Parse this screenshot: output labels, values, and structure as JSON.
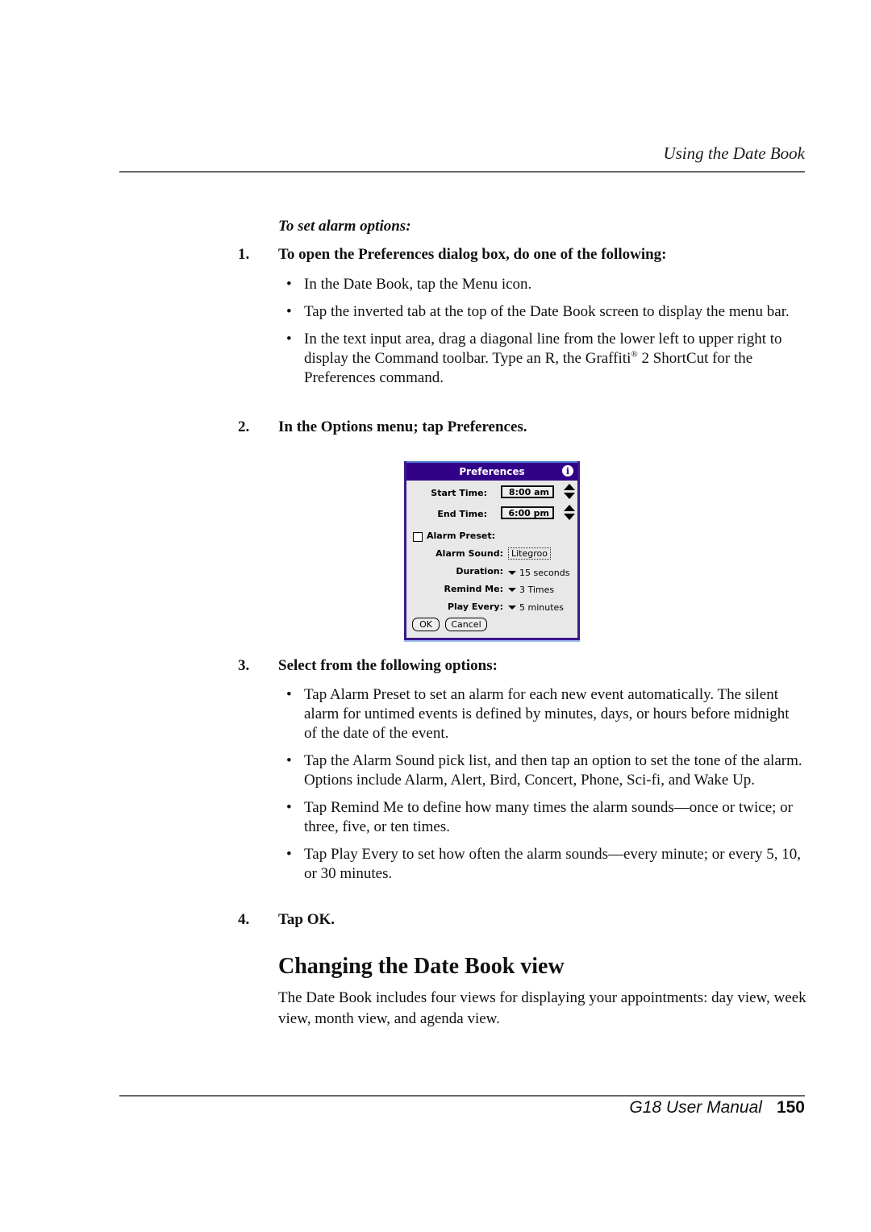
{
  "header": {
    "running_title": "Using the Date Book"
  },
  "procedure": {
    "title": "To set alarm options:",
    "steps": [
      {
        "number": "1.",
        "text": "To open the Preferences dialog box, do one of the following:",
        "bullets": [
          "In the Date Book, tap the Menu icon.",
          "Tap the inverted tab at the top of the Date Book screen to display the menu bar.",
          "In the text input area, drag a diagonal line from the lower left to upper right to display the Command toolbar. Type an R, the Graffiti",
          "®",
          " 2 ShortCut for the Preferences command."
        ]
      },
      {
        "number": "2.",
        "text": "In the Options menu; tap Preferences."
      },
      {
        "number": "3.",
        "text": "Select from the following options:",
        "bullets": [
          "Tap Alarm Preset to set an alarm for each new event automatically. The silent alarm for untimed events is defined by minutes, days, or hours before midnight of the date of the event.",
          "Tap the Alarm Sound pick list, and then tap an option to set the tone of the alarm. Options include Alarm, Alert, Bird, Concert, Phone, Sci-fi, and Wake Up.",
          "Tap Remind Me to define how many times the alarm sounds—once or twice; or three, five, or ten times.",
          "Tap Play Every to set how often the alarm sounds—every minute; or every 5, 10, or 30 minutes."
        ]
      },
      {
        "number": "4.",
        "text": "Tap OK."
      }
    ]
  },
  "dialog": {
    "title": "Preferences",
    "info_icon": "i",
    "start_time_label": "Start Time:",
    "start_time_value": "8:00 am",
    "end_time_label": "End Time:",
    "end_time_value": "6:00 pm",
    "alarm_preset_label": "Alarm Preset:",
    "alarm_preset_checked": false,
    "alarm_sound_label": "Alarm Sound:",
    "alarm_sound_value": "Litegroo",
    "duration_label": "Duration:",
    "duration_value": "15 seconds",
    "remind_me_label": "Remind Me:",
    "remind_me_value": "3 Times",
    "play_every_label": "Play Every:",
    "play_every_value": "5 minutes",
    "ok_label": "OK",
    "cancel_label": "Cancel",
    "colors": {
      "title_bar": "#330088",
      "frame": "#3a1a8c",
      "body": "#e8e8e8"
    }
  },
  "section": {
    "heading": "Changing the Date Book view",
    "paragraph": "The Date Book includes four views for displaying your appointments: day view, week view, month view, and agenda view."
  },
  "footer": {
    "manual_title": "G18 User Manual",
    "page_number": "150"
  }
}
